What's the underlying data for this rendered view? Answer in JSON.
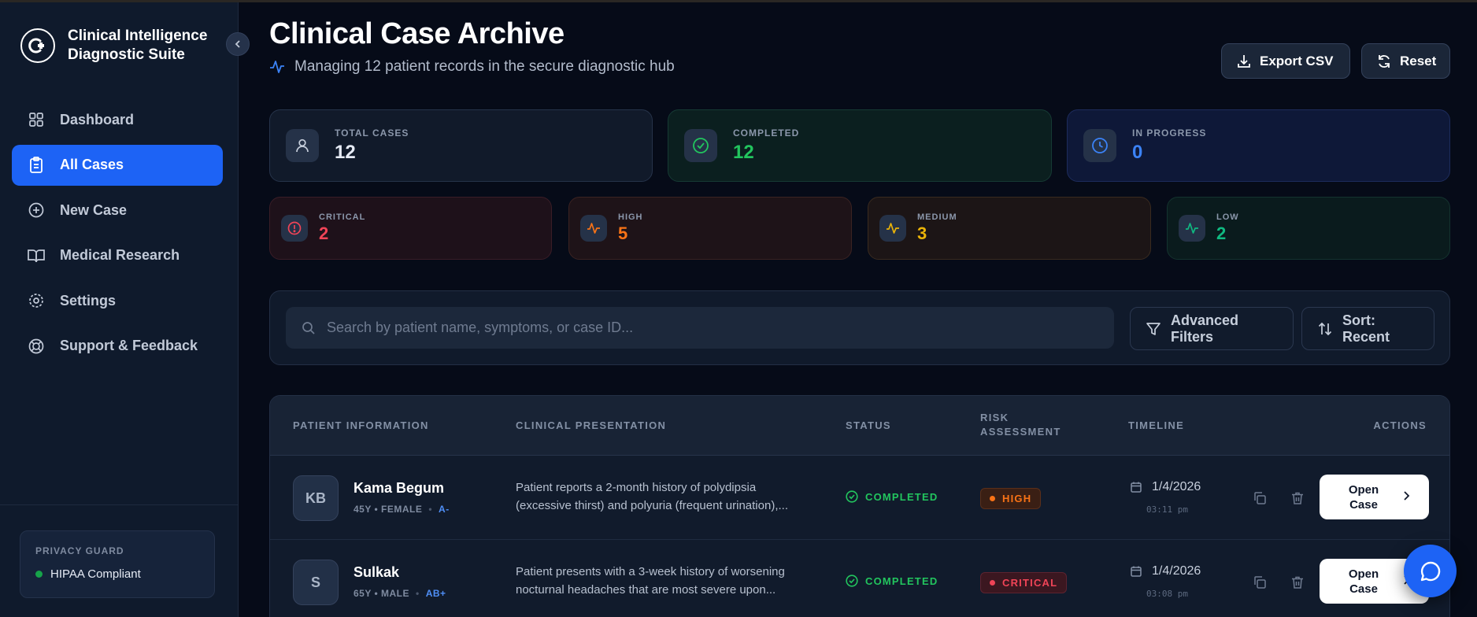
{
  "app": {
    "brand_line1": "Clinical Intelligence",
    "brand_line2": "Diagnostic Suite"
  },
  "sidebar": {
    "items": [
      {
        "label": "Dashboard",
        "icon": "grid-icon",
        "active": false
      },
      {
        "label": "All Cases",
        "icon": "clipboard-icon",
        "active": true
      },
      {
        "label": "New Case",
        "icon": "plus-circle-icon",
        "active": false
      },
      {
        "label": "Medical Research",
        "icon": "book-open-icon",
        "active": false
      },
      {
        "label": "Settings",
        "icon": "settings-icon",
        "active": false
      },
      {
        "label": "Support & Feedback",
        "icon": "lifebuoy-icon",
        "active": false
      }
    ],
    "privacy": {
      "title": "PRIVACY GUARD",
      "status": "HIPAA Compliant"
    }
  },
  "header": {
    "title": "Clinical Case Archive",
    "subtitle": "Managing 12 patient records in the secure diagnostic hub",
    "export_label": "Export CSV",
    "reset_label": "Reset"
  },
  "stats": {
    "total": {
      "label": "TOTAL CASES",
      "value": "12"
    },
    "completed": {
      "label": "COMPLETED",
      "value": "12"
    },
    "in_progress": {
      "label": "IN PROGRESS",
      "value": "0"
    },
    "critical": {
      "label": "CRITICAL",
      "value": "2"
    },
    "high": {
      "label": "HIGH",
      "value": "5"
    },
    "medium": {
      "label": "MEDIUM",
      "value": "3"
    },
    "low": {
      "label": "LOW",
      "value": "2"
    }
  },
  "search": {
    "placeholder": "Search by patient name, symptoms, or case ID...",
    "filters_label": "Advanced Filters",
    "sort_label": "Sort: Recent"
  },
  "table": {
    "headers": {
      "patient": "PATIENT INFORMATION",
      "clinical": "CLINICAL PRESENTATION",
      "status": "STATUS",
      "risk_line1": "RISK",
      "risk_line2": "ASSESSMENT",
      "timeline": "TIMELINE",
      "actions": "ACTIONS"
    },
    "rows": [
      {
        "initials": "KB",
        "name": "Kama Begum",
        "age_sex": "45Y • FEMALE",
        "blood": "A-",
        "desc_line1": "Patient reports a 2-month history of polydipsia",
        "desc_line2": "(excessive thirst) and polyuria (frequent urination),...",
        "status": "COMPLETED",
        "risk": "HIGH",
        "date": "1/4/2026",
        "time": "03:11 pm",
        "open_line1": "Open",
        "open_line2": "Case"
      },
      {
        "initials": "S",
        "name": "Sulkak",
        "age_sex": "65Y • MALE",
        "blood": "AB+",
        "desc_line1": "Patient presents with a 3-week history of worsening",
        "desc_line2": "nocturnal headaches that are most severe upon...",
        "status": "COMPLETED",
        "risk": "CRITICAL",
        "date": "1/4/2026",
        "time": "03:08 pm",
        "open_line1": "Open",
        "open_line2": "Case"
      }
    ]
  },
  "colors": {
    "accent": "#1d63f5",
    "completed": "#22c55e",
    "in_progress": "#3b82f6",
    "critical": "#f04457",
    "high": "#f97316",
    "medium": "#eab308",
    "low": "#10b981"
  }
}
